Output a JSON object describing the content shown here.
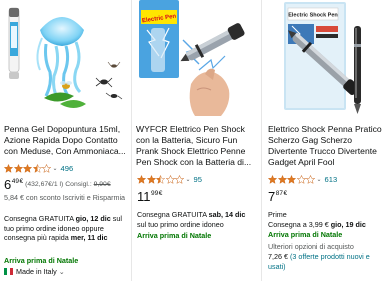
{
  "colors": {
    "star": "#de7921",
    "link": "#007185",
    "green": "#007600",
    "muted": "#565959",
    "text": "#0f1111"
  },
  "products": [
    {
      "title": "Penna Gel Dopopuntura 15ml, Azione Rapida Dopo Contatto con Meduse, Con Ammoniaca...",
      "rating": 3.5,
      "review_count": "496",
      "price_whole": "6",
      "price_fraction": "49",
      "price_currency": "€",
      "unit_price": "(432,67€/1 l)",
      "consigl_label": "Consigl.:",
      "list_price": "9,90€",
      "savings": "5,84 € con sconto Iscriviti e Risparmia",
      "delivery_prefix": "Consegna GRATUITA",
      "delivery_date": "gio, 12 dic",
      "delivery_suffix": "sul tuo primo ordine idoneo",
      "fast_prefix": "oppure consegna più rapida",
      "fast_date": "mer, 11 dic",
      "badge": "Arriva prima di Natale",
      "origin": "Made in Italy",
      "origin_chevron": "⌄"
    },
    {
      "title": "WYFCR Elettrico Pen Shock con la Batteria, Sicuro Fun Prank Shock Elettrico Penne Pen Shock con la Batteria di...",
      "rating": 2.5,
      "review_count": "95",
      "price_whole": "11",
      "price_fraction": "99",
      "price_currency": "€",
      "delivery_prefix": "Consegna GRATUITA",
      "delivery_date": "sab, 14 dic",
      "delivery_suffix": "sul tuo primo ordine idoneo",
      "badge": "Arriva prima di Natale",
      "packaging_text": "Electric Pen"
    },
    {
      "title": "Elettrico Shock Penna Pratico Scherzo Gag Scherzo Divertente Trucco Divertente Gadget April Fool",
      "rating": 3.0,
      "review_count": "613",
      "price_whole": "7",
      "price_fraction": "87",
      "price_currency": "€",
      "prime": "Prime",
      "delivery_prefix": "Consegna a 3,99 €",
      "delivery_date": "gio, 19 dic",
      "badge": "Arriva prima di Natale",
      "more_options": "Ulteriori opzioni di acquisto",
      "more_price": "7,26 €",
      "more_offers": "(3 offerte prodotti nuovi e usati)",
      "packaging_text": "Electric Shock Pen"
    }
  ]
}
